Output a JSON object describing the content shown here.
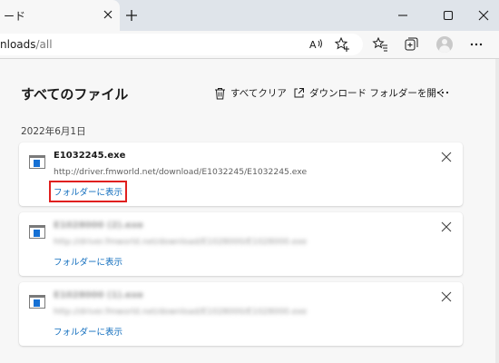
{
  "tab": {
    "title": "ード"
  },
  "address": {
    "host_fragment": "nloads",
    "path": "/all"
  },
  "page": {
    "heading": "すべてのファイル",
    "clear_all": "すべてクリア",
    "open_folder": "ダウンロード フォルダーを開く"
  },
  "date": "2022年6月1日",
  "downloads": [
    {
      "filename": "E1032245.exe",
      "url": "http://driver.fmworld.net/download/E1032245/E1032245.exe",
      "show_folder": "フォルダーに表示"
    },
    {
      "filename": "E1028000 (2).exe",
      "url": "http://driver.fmworld.net/download/E1028000/E1028000.exe",
      "show_folder": "フォルダーに表示"
    },
    {
      "filename": "E1028000 (1).exe",
      "url": "http://driver.fmworld.net/download/E1028000/E1028000.exe",
      "show_folder": "フォルダーに表示"
    }
  ],
  "colors": {
    "link": "#0f6cbd",
    "highlight_border": "#e0201f",
    "file_icon": "#1570d4",
    "tabstrip": "#dfe4ea"
  },
  "icons": {
    "tab_close": "close-icon",
    "new_tab": "plus-icon",
    "minimize": "minimize-icon",
    "maximize": "maximize-icon",
    "close_window": "close-icon",
    "read_aloud": "read-aloud-icon",
    "add_favorite": "star-plus-icon",
    "favorites": "favorites-icon",
    "collections": "collections-icon",
    "profile": "profile-icon",
    "settings_more": "more-icon",
    "clear_all": "trash-icon",
    "open_folder": "open-external-icon"
  }
}
